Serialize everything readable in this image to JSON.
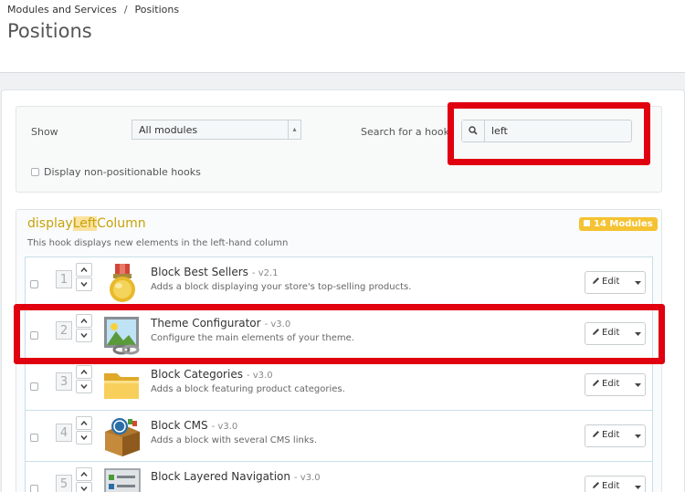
{
  "breadcrumb": {
    "parent": "Modules and Services",
    "separator": "/",
    "current": "Positions"
  },
  "page_title": "Positions",
  "filter": {
    "show_label": "Show",
    "show_value": "All modules",
    "search_label": "Search for a hook",
    "search_value": "left",
    "non_positionable_label": "Display non-positionable hooks"
  },
  "hook": {
    "name_prefix": "display",
    "name_match": "Left",
    "name_suffix": "Column",
    "description": "This hook displays new elements in the left-hand column",
    "badge": "14 Modules"
  },
  "edit_label": "Edit",
  "modules": [
    {
      "position": "1",
      "name": "Block Best Sellers",
      "version": "- v2.1",
      "description": "Adds a block displaying your store's top-selling products.",
      "icon": "medal-icon"
    },
    {
      "position": "2",
      "name": "Theme Configurator",
      "version": "- v3.0",
      "description": "Configure the main elements of your theme.",
      "icon": "image-link-icon"
    },
    {
      "position": "3",
      "name": "Block Categories",
      "version": "- v3.0",
      "description": "Adds a block featuring product categories.",
      "icon": "folder-icon"
    },
    {
      "position": "4",
      "name": "Block CMS",
      "version": "- v3.0",
      "description": "Adds a block with several CMS links.",
      "icon": "wordpress-box-icon"
    },
    {
      "position": "5",
      "name": "Block Layered Navigation",
      "version": "- v3.0",
      "description": "",
      "icon": "layered-navigation-icon"
    }
  ],
  "colors": {
    "highlight_box": "#e0000f",
    "hook_title": "#c6a30a",
    "badge": "#f5c232"
  }
}
